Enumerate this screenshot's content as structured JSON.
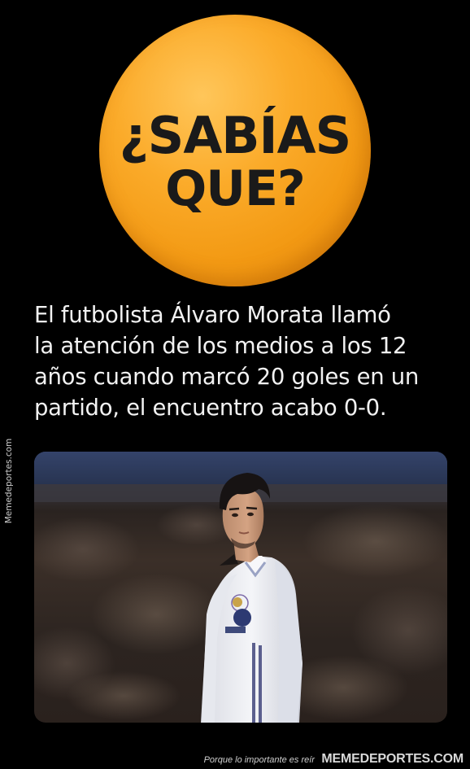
{
  "badge": {
    "line1": "¿SABÍAS",
    "line2": "QUE?"
  },
  "caption": {
    "lines": [
      "El futbolista Álvaro Morata llamó",
      "la atención de los medios a los 12",
      "años cuando marcó 20 goles en un",
      "partido, el encuentro acabo 0-0."
    ]
  },
  "side_watermark": "Memedeportes.com",
  "footer": {
    "slogan": "Porque lo importante es reír",
    "brand": "MEMEDEPORTES.COM"
  },
  "colors": {
    "background": "#000000",
    "badge_orange": "#f7a21e",
    "badge_text": "#1a1a1a",
    "caption_text": "#f2f2f2"
  }
}
